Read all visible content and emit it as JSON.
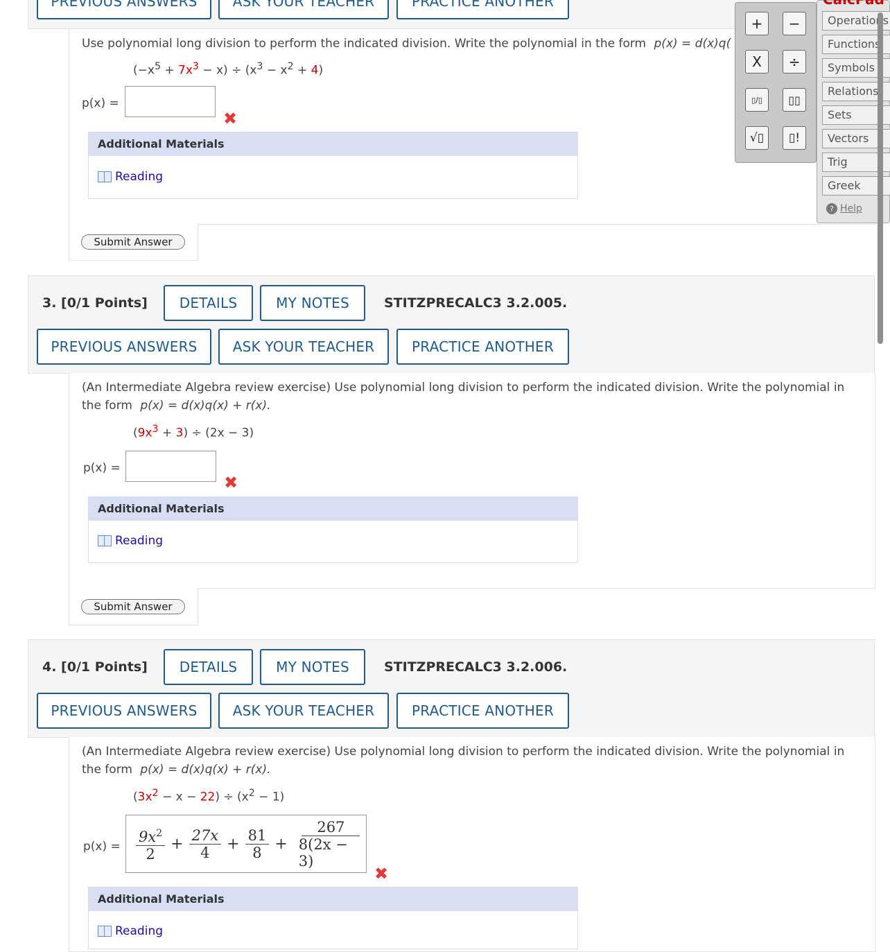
{
  "prev_question": {
    "buttons": [
      "PREVIOUS ANSWERS",
      "ASK YOUR TEACHER",
      "PRACTICE ANOTHER"
    ],
    "text": "Use polynomial long division to perform the indicated division. Write the polynomial in the form",
    "form": "p(x) = d(x)q(",
    "expr": {
      "a": "(−x",
      "a_sup": "5",
      "b": " + ",
      "c": "7x",
      "c_sup": "3",
      "d": " − x) ÷ (x",
      "d_sup": "3",
      "e": " − x",
      "e_sup": "2",
      "f": " + ",
      "g": "4",
      "h": ")"
    },
    "plabel": "p(x) =",
    "additional": "Additional Materials",
    "reading": "Reading",
    "submit": "Submit Answer"
  },
  "q3": {
    "points": "3. [0/1 Points]",
    "details": "DETAILS",
    "notes": "MY NOTES",
    "code": "STITZPRECALC3 3.2.005.",
    "buttons": [
      "PREVIOUS ANSWERS",
      "ASK YOUR TEACHER",
      "PRACTICE ANOTHER"
    ],
    "text1": "(An Intermediate Algebra review exercise) Use polynomial long division to perform the indicated division. Write the polynomial in",
    "text2a": "the form",
    "text2b": "p(x) = d(x)q(x) + r(x).",
    "expr": {
      "a": "(",
      "b": "9x",
      "b_sup": "3",
      "c": " + ",
      "d": "3",
      "e": ") ÷ (2x − 3)"
    },
    "plabel": "p(x) =",
    "additional": "Additional Materials",
    "reading": "Reading",
    "submit": "Submit Answer"
  },
  "q4": {
    "points": "4. [0/1 Points]",
    "details": "DETAILS",
    "notes": "MY NOTES",
    "code": "STITZPRECALC3 3.2.006.",
    "buttons": [
      "PREVIOUS ANSWERS",
      "ASK YOUR TEACHER",
      "PRACTICE ANOTHER"
    ],
    "text1": "(An Intermediate Algebra review exercise) Use polynomial long division to perform the indicated division. Write the polynomial in",
    "text2a": "the form",
    "text2b": "p(x) = d(x)q(x) + r(x).",
    "expr": {
      "a": "(",
      "b": "3x",
      "b_sup": "2",
      "c": " − x − ",
      "d": "22",
      "e": ") ÷ (x",
      "e_sup": "2",
      "f": " − 1)"
    },
    "plabel": "p(x) =",
    "answer": {
      "f1n": "9x",
      "f1n_sup": "2",
      "f1d": "2",
      "op1": "+",
      "f2n": "27x",
      "f2d": "4",
      "op2": "+",
      "f3n": "81",
      "f3d": "8",
      "op3": "+",
      "f4n": "267",
      "f4d": "8(2x − 3)"
    },
    "additional": "Additional Materials",
    "reading": "Reading"
  },
  "calcpad": {
    "title": "CalcPad",
    "keys": [
      "+",
      "−",
      "X",
      "÷",
      "▯/▯",
      "▯▯",
      "√▯",
      "▯!"
    ],
    "menu": [
      "Operations",
      "Functions",
      "Symbols",
      "Relations",
      "Sets",
      "Vectors",
      "Trig",
      "Greek"
    ],
    "help": "Help"
  },
  "colors": {
    "accent": "#1f5a8c",
    "error": "#e53935",
    "highlight": "#c00000",
    "panel": "#d8def4"
  }
}
